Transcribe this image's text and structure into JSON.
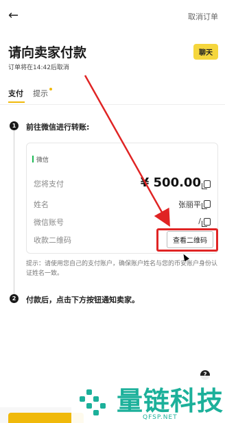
{
  "header": {
    "cancel_label": "取消订单"
  },
  "page": {
    "title": "请向卖家付款",
    "chat_label": "聊天",
    "order_note": "订单将在14:42后取消"
  },
  "tabs": [
    {
      "label": "支付"
    },
    {
      "label": "提示"
    }
  ],
  "steps": [
    {
      "num": "1",
      "text": "前往微信进行转账:"
    },
    {
      "num": "2",
      "text": "付款后，点击下方按钮通知卖家。"
    }
  ],
  "card": {
    "method": "微信",
    "rows": {
      "pay_label": "您将支付",
      "pay_amount": "¥ 500.00",
      "name_label": "姓名",
      "name_value": "张丽平",
      "account_label": "微信账号",
      "account_value": "/",
      "qr_label": "收款二维码",
      "qr_button": "查看二维码"
    }
  },
  "hint": "提示：请使用您自己的支付账户，确保账户姓名与您的币安账户身份认证姓名一致。",
  "help_icon": "?",
  "watermark": {
    "text": "量链科技",
    "sub": "QFSP.NET"
  },
  "colors": {
    "accent": "#f0b90b",
    "annotation": "#e02424",
    "watermark": "#1cb09a"
  }
}
